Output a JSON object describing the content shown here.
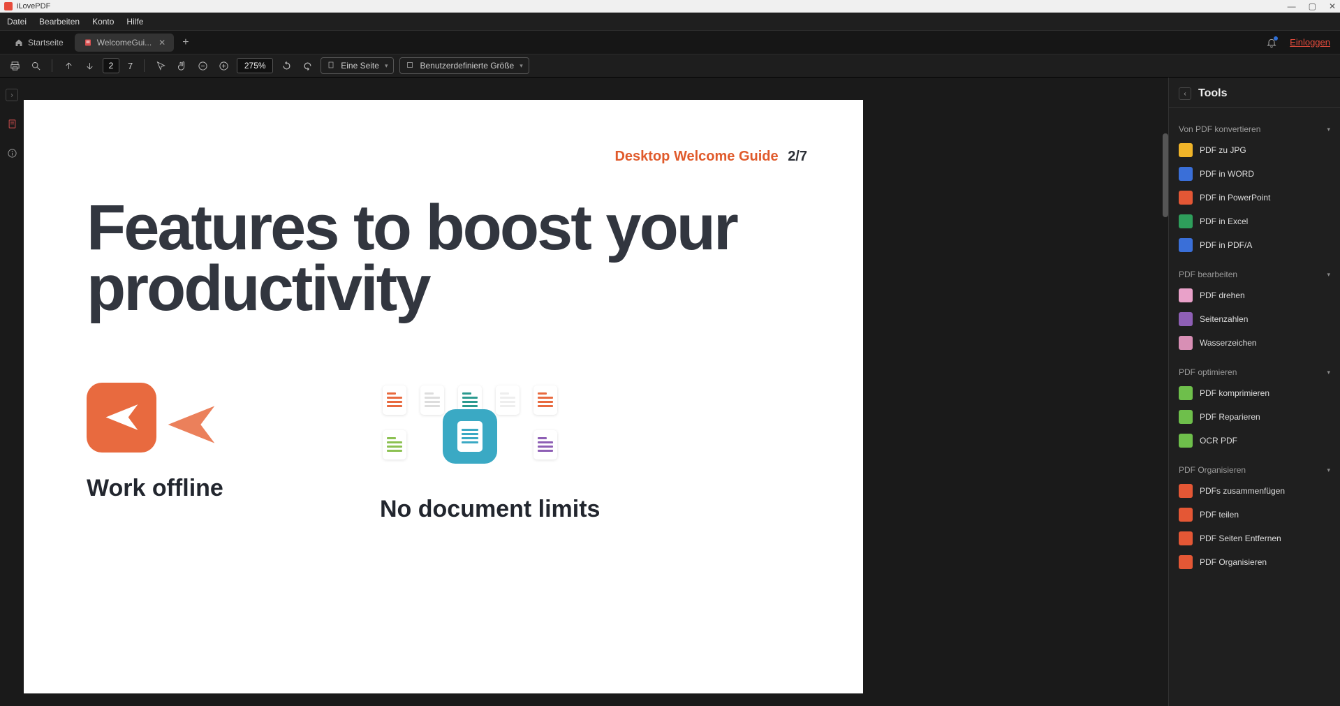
{
  "app": {
    "title": "iLovePDF"
  },
  "window_controls": {
    "min": "—",
    "max": "▢",
    "close": "✕"
  },
  "menubar": [
    "Datei",
    "Bearbeiten",
    "Konto",
    "Hilfe"
  ],
  "tabs": {
    "home": "Startseite",
    "active": "WelcomeGui...",
    "add": "+"
  },
  "login": "Einloggen",
  "toolbar": {
    "page_current": "2",
    "page_total": "7",
    "zoom": "275%",
    "layout": "Eine Seite",
    "size": "Benutzerdefinierte Größe"
  },
  "doc": {
    "header_label": "Desktop Welcome Guide",
    "header_page": "2/7",
    "heading": "Features to boost your productivity",
    "feature1": "Work offline",
    "feature2": "No document limits"
  },
  "tools": {
    "title": "Tools",
    "sections": [
      {
        "title": "Von PDF konvertieren",
        "items": [
          {
            "label": "PDF zu JPG",
            "color": "#f0b429"
          },
          {
            "label": "PDF in WORD",
            "color": "#3a6fd8"
          },
          {
            "label": "PDF in PowerPoint",
            "color": "#e45735"
          },
          {
            "label": "PDF in Excel",
            "color": "#2e9e5b"
          },
          {
            "label": "PDF in PDF/A",
            "color": "#3a6fd8"
          }
        ]
      },
      {
        "title": "PDF bearbeiten",
        "items": [
          {
            "label": "PDF drehen",
            "color": "#e9a1c9"
          },
          {
            "label": "Seitenzahlen",
            "color": "#8e5fb5"
          },
          {
            "label": "Wasserzeichen",
            "color": "#d88fb5"
          }
        ]
      },
      {
        "title": "PDF optimieren",
        "items": [
          {
            "label": "PDF komprimieren",
            "color": "#6ebf4b"
          },
          {
            "label": "PDF Reparieren",
            "color": "#6ebf4b"
          },
          {
            "label": "OCR PDF",
            "color": "#6ebf4b"
          }
        ]
      },
      {
        "title": "PDF Organisieren",
        "items": [
          {
            "label": "PDFs zusammenfügen",
            "color": "#e45735"
          },
          {
            "label": "PDF teilen",
            "color": "#e45735"
          },
          {
            "label": "PDF Seiten Entfernen",
            "color": "#e45735"
          },
          {
            "label": "PDF Organisieren",
            "color": "#e45735"
          }
        ]
      }
    ]
  }
}
